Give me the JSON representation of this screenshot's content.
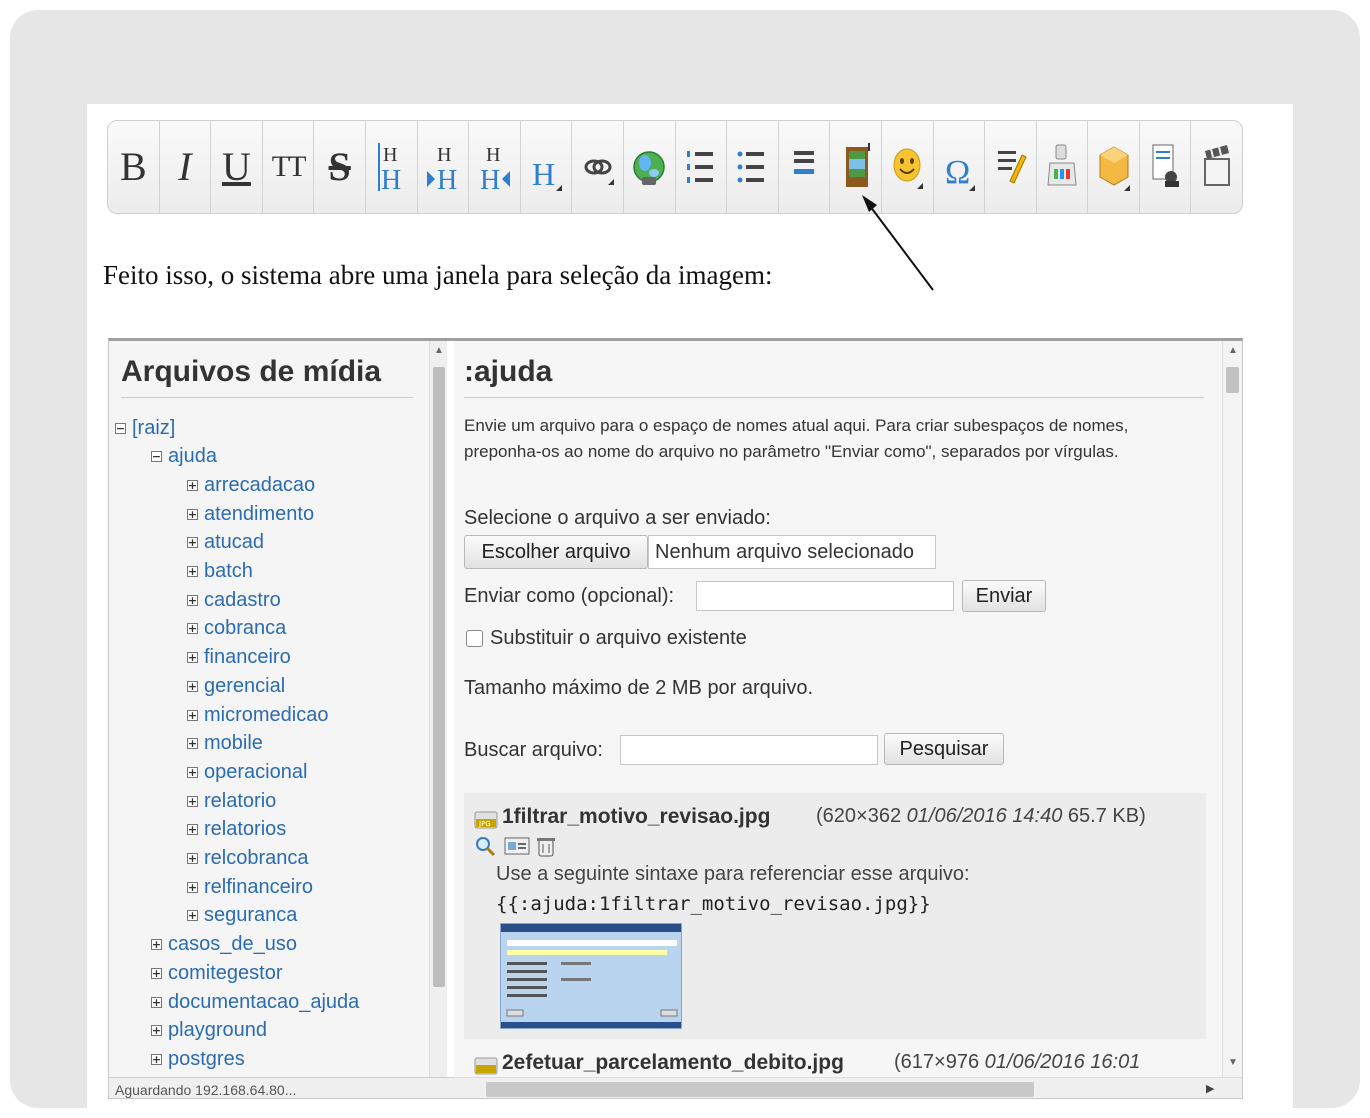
{
  "toolbar": {
    "buttons": [
      {
        "name": "bold-button",
        "glyph": "B"
      },
      {
        "name": "italic-button",
        "glyph": "I"
      },
      {
        "name": "underline-button",
        "glyph": "U"
      },
      {
        "name": "monospace-button",
        "glyph": "TT"
      },
      {
        "name": "strikethrough-button",
        "glyph": "S"
      },
      {
        "name": "heading-same-level-button",
        "icon": "heading-icon"
      },
      {
        "name": "heading-lower-button",
        "icon": "heading-lower-icon"
      },
      {
        "name": "heading-higher-button",
        "icon": "heading-higher-icon"
      },
      {
        "name": "headings-menu-button",
        "icon": "heading-menu-icon"
      },
      {
        "name": "link-button",
        "icon": "link-icon"
      },
      {
        "name": "external-link-button",
        "icon": "globe-icon"
      },
      {
        "name": "ordered-list-button",
        "icon": "ordered-list-icon"
      },
      {
        "name": "unordered-list-button",
        "icon": "unordered-list-icon"
      },
      {
        "name": "horizontal-rule-button",
        "icon": "hr-icon"
      },
      {
        "name": "add-image-button",
        "icon": "image-icon"
      },
      {
        "name": "smileys-button",
        "icon": "smiley-icon"
      },
      {
        "name": "special-chars-button",
        "icon": "omega-icon"
      },
      {
        "name": "signature-button",
        "icon": "signature-icon"
      },
      {
        "name": "wrap-button",
        "icon": "wrap-icon"
      },
      {
        "name": "box-button",
        "icon": "box-icon"
      },
      {
        "name": "preview-button",
        "icon": "document-search-icon"
      },
      {
        "name": "video-button",
        "icon": "clapper-icon"
      }
    ]
  },
  "caption": "Feito isso, o sistema abre uma janela para seleção da imagem:",
  "media": {
    "left_title": "Arquivos de mídia",
    "tree": [
      {
        "label": "[raiz]",
        "level": 0,
        "open": true
      },
      {
        "label": "ajuda",
        "level": 1,
        "open": true
      },
      {
        "label": "arrecadacao",
        "level": 2
      },
      {
        "label": "atendimento",
        "level": 2
      },
      {
        "label": "atucad",
        "level": 2
      },
      {
        "label": "batch",
        "level": 2
      },
      {
        "label": "cadastro",
        "level": 2
      },
      {
        "label": "cobranca",
        "level": 2
      },
      {
        "label": "financeiro",
        "level": 2
      },
      {
        "label": "gerencial",
        "level": 2
      },
      {
        "label": "micromedicao",
        "level": 2
      },
      {
        "label": "mobile",
        "level": 2
      },
      {
        "label": "operacional",
        "level": 2
      },
      {
        "label": "relatorio",
        "level": 2
      },
      {
        "label": "relatorios",
        "level": 2
      },
      {
        "label": "relcobranca",
        "level": 2
      },
      {
        "label": "relfinanceiro",
        "level": 2
      },
      {
        "label": "seguranca",
        "level": 2
      },
      {
        "label": "casos_de_uso",
        "level": 1
      },
      {
        "label": "comitegestor",
        "level": 1
      },
      {
        "label": "documentacao_ajuda",
        "level": 1
      },
      {
        "label": "playground",
        "level": 1
      },
      {
        "label": "postgres",
        "level": 1
      }
    ],
    "right_title": ":ajuda",
    "info_text": "Envie um arquivo para o espaço de nomes atual aqui. Para criar subespaços de nomes, preponha-os ao nome do arquivo no parâmetro \"Enviar como\", separados por vírgulas.",
    "select_label": "Selecione o arquivo a ser enviado:",
    "choose_button": "Escolher arquivo",
    "no_file": "Nenhum arquivo selecionado",
    "send_as_label": "Enviar como (opcional):",
    "send_button": "Enviar",
    "overwrite_label": "Substituir o arquivo existente",
    "max_size": "Tamanho máximo de 2 MB por arquivo.",
    "search_label": "Buscar arquivo:",
    "search_button": "Pesquisar",
    "file1": {
      "name": "1filtrar_motivo_revisao.jpg",
      "dims": "(620×362",
      "date": "01/06/2016 14:40",
      "size": "65.7 KB)",
      "use_text": "Use a seguinte sintaxe para referenciar esse arquivo:",
      "code": "{{:ajuda:1filtrar_motivo_revisao.jpg}}"
    },
    "file2": {
      "name": "2efetuar_parcelamento_debito.jpg",
      "dims": "(617×976",
      "date": "01/06/2016 16:01"
    },
    "status": "Aguardando 192.168.64.80..."
  }
}
